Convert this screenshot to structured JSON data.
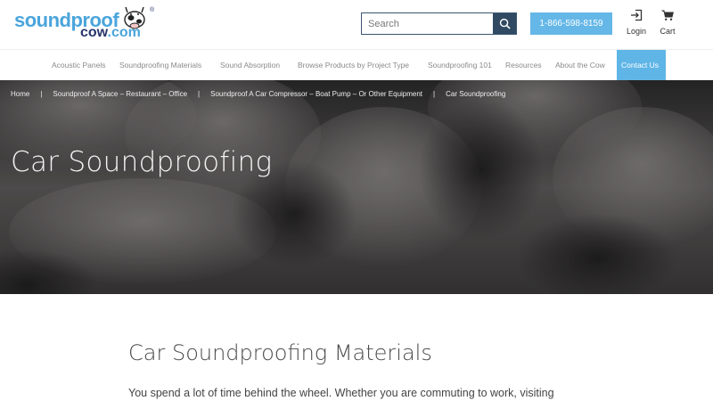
{
  "logo": {
    "word1": "soundproof",
    "word2": "cow",
    "tld": ".com",
    "reg": "®"
  },
  "search": {
    "placeholder": "Search",
    "icon": "search-icon"
  },
  "phone": "1-866-598-8159",
  "header_icons": {
    "login": {
      "label": "Login",
      "icon": "login-icon"
    },
    "cart": {
      "label": "Cart",
      "icon": "cart-icon"
    }
  },
  "nav": {
    "items": [
      {
        "label": "Acoustic Panels"
      },
      {
        "label": "Soundproofing Materials"
      },
      {
        "label": "Sound Absorption"
      },
      {
        "label": "Browse Products by Project Type"
      },
      {
        "label": "Soundproofing 101"
      },
      {
        "label": "Resources"
      },
      {
        "label": "About the Cow"
      },
      {
        "label": "Contact Us"
      }
    ]
  },
  "breadcrumb": {
    "items": [
      "Home",
      "Soundproof A Space – Restaurant – Office",
      "Soundproof A Car Compressor – Boat Pump – Or Other Equipment",
      "Car Soundproofing"
    ],
    "separator": "|"
  },
  "hero": {
    "title": "Car Soundproofing"
  },
  "main": {
    "section_title": "Car Soundproofing Materials",
    "paragraph": "You spend a lot of time behind the wheel. Whether you are commuting to work, visiting"
  },
  "colors": {
    "accent": "#5fb5e6",
    "brand_dark": "#29366b",
    "search_btn": "#2f4a62"
  }
}
